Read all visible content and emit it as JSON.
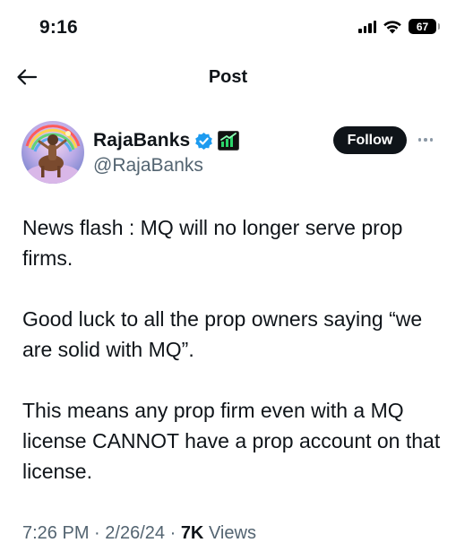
{
  "status_bar": {
    "time": "9:16",
    "battery_level": "67",
    "icons": [
      "cellular-signal-icon",
      "wifi-icon",
      "battery-icon"
    ]
  },
  "header": {
    "title": "Post",
    "back_icon": "back-arrow-icon"
  },
  "author": {
    "display_name": "RajaBanks",
    "handle": "@RajaBanks",
    "verified_color": "#1d9bf0",
    "follow_label": "Follow",
    "more_icon": "more-dots-icon"
  },
  "post": {
    "paragraphs": [
      "News flash : MQ will no longer serve prop firms.",
      "Good luck to all the prop owners saying “we are solid with MQ”.",
      "This means any prop firm even with a MQ license CANNOT have a prop account on that license."
    ]
  },
  "meta": {
    "time": "7:26 PM",
    "separator": "·",
    "date": "2/26/24",
    "views_count": "7K",
    "views_label": "Views"
  },
  "colors": {
    "text": "#0f1419",
    "secondary": "#536471",
    "follow_bg": "#0f1419"
  }
}
